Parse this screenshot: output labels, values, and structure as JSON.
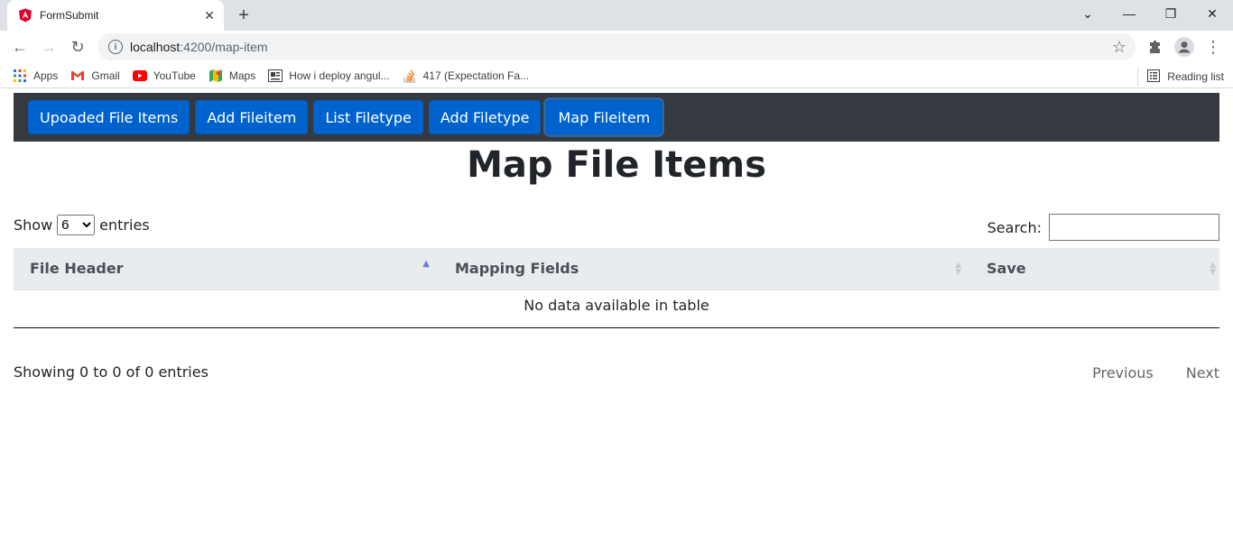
{
  "browser": {
    "tab_title": "FormSubmit",
    "url_host": "localhost",
    "url_path": ":4200/map-item",
    "bookmarks": [
      "Apps",
      "Gmail",
      "YouTube",
      "Maps",
      "How i deploy angul...",
      "417 (Expectation Fa..."
    ],
    "reading_list": "Reading list"
  },
  "nav": {
    "buttons": [
      "Upoaded File Items",
      "Add Fileitem",
      "List Filetype",
      "Add Filetype",
      "Map Fileitem"
    ],
    "active_index": 4
  },
  "page": {
    "title": "Map File Items",
    "show_label": "Show",
    "entries_label": "entries",
    "length_value": "6",
    "search_label": "Search:",
    "search_value": "",
    "columns": [
      "File Header",
      "Mapping Fields",
      "Save"
    ],
    "empty_message": "No data available in table",
    "info": "Showing 0 to 0 of 0 entries",
    "prev": "Previous",
    "next": "Next"
  },
  "colors": {
    "navbar_bg": "#343a40",
    "button_bg": "#0062cc",
    "thead_bg": "#e9ecef"
  }
}
